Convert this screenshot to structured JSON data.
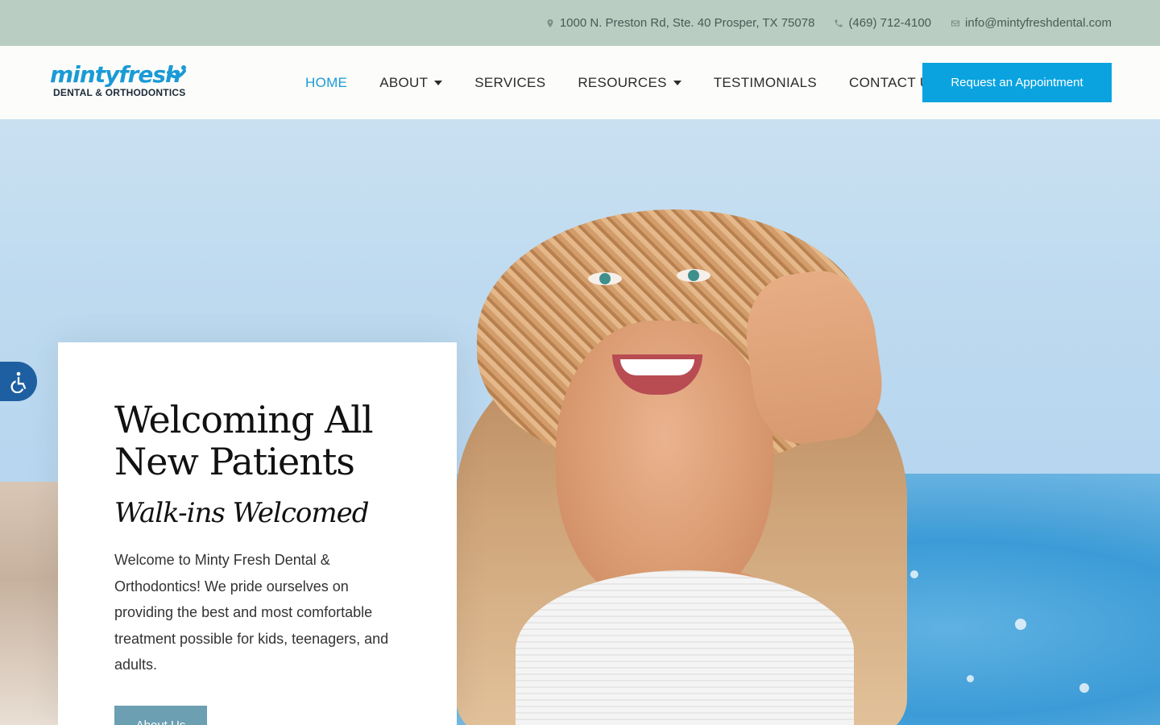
{
  "topbar": {
    "address": "1000 N. Preston Rd, Ste. 40 Prosper, TX 75078",
    "phone": "(469) 712-4100",
    "email": "info@mintyfreshdental.com"
  },
  "logo": {
    "top": "mintyfresh",
    "bottom": "DENTAL & ORTHODONTICS"
  },
  "nav": {
    "items": [
      {
        "label": "HOME",
        "active": true
      },
      {
        "label": "ABOUT",
        "dropdown": true
      },
      {
        "label": "SERVICES"
      },
      {
        "label": "RESOURCES",
        "dropdown": true
      },
      {
        "label": "TESTIMONIALS"
      },
      {
        "label": "CONTACT US"
      }
    ],
    "cta": "Request an Appointment"
  },
  "hero": {
    "title_line1": "Welcoming All",
    "title_line2": "New Patients",
    "subtitle": "Walk-ins Welcomed",
    "body": "Welcome to Minty Fresh Dental & Orthodontics! We pride ourselves on providing the best and most comfortable treatment possible for kids, teenagers, and adults.",
    "button": "About Us"
  },
  "colors": {
    "topbar_bg": "#b9cdc3",
    "accent": "#1b9ad6",
    "cta_bg": "#0aa3e0",
    "about_btn_bg": "#6b9fb1",
    "accessibility_bg": "#1d5fa0"
  },
  "icons": [
    "map-pin-icon",
    "phone-icon",
    "mail-icon",
    "accessibility-icon"
  ]
}
